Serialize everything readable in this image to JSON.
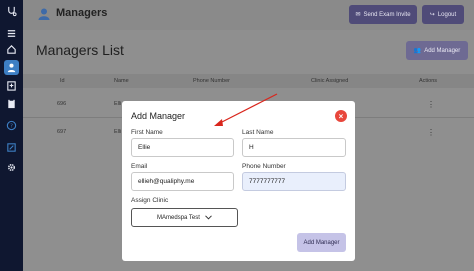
{
  "header": {
    "title": "Managers",
    "send_invite_label": "Send Exam Invite",
    "logout_label": "Logout"
  },
  "page": {
    "title": "Managers List",
    "add_manager_label": "Add Manager"
  },
  "table": {
    "columns": [
      "Id",
      "Name",
      "Phone Number",
      "Clinic Assigned",
      "Actions"
    ],
    "rows": [
      {
        "id": "696",
        "name": "Elli"
      },
      {
        "id": "697",
        "name": "Elli"
      }
    ],
    "actions_glyph": "⋮"
  },
  "sidebar": {
    "icons": [
      "stethoscope-icon",
      "menu-icon",
      "home-icon",
      "user-icon",
      "hospital-icon",
      "clipboard-icon",
      "help-icon",
      "edit-icon",
      "gear-icon"
    ]
  },
  "modal": {
    "title": "Add Manager",
    "first_name_label": "First Name",
    "first_name_value": "Ellie",
    "last_name_label": "Last Name",
    "last_name_value": "H",
    "email_label": "Email",
    "email_value": "ellieh@qualiphy.me",
    "phone_label": "Phone Number",
    "phone_value": "7777777777",
    "clinic_label": "Assign Clinic",
    "clinic_value": "MAmedspa Test",
    "submit_label": "Add Manager"
  },
  "colors": {
    "sidebar_bg": "#0f1730",
    "accent": "#4f4b78",
    "close": "#e8473c",
    "annotation_arrow": "#d9261c"
  }
}
